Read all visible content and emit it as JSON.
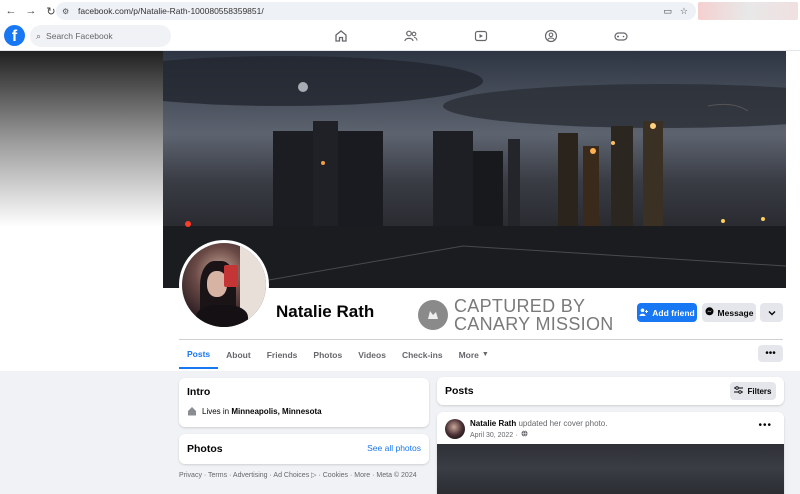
{
  "browser": {
    "url": "facebook.com/p/Natalie-Rath-100080558359851/"
  },
  "nav": {
    "search_placeholder": "Search Facebook"
  },
  "profile": {
    "name": "Natalie Rath",
    "watermark_line1": "CAPTURED BY",
    "watermark_line2": "CANARY MISSION",
    "add_friend_label": "Add friend",
    "message_label": "Message"
  },
  "tabs": [
    {
      "label": "Posts",
      "active": true
    },
    {
      "label": "About"
    },
    {
      "label": "Friends"
    },
    {
      "label": "Photos"
    },
    {
      "label": "Videos"
    },
    {
      "label": "Check-ins"
    },
    {
      "label": "More"
    }
  ],
  "intro": {
    "title": "Intro",
    "lives_prefix": "Lives in",
    "location": "Minneapolis, Minnesota"
  },
  "photos": {
    "title": "Photos",
    "see_all": "See all photos"
  },
  "footer": "Privacy · Terms · Advertising · Ad Choices ▷ · Cookies · More · Meta © 2024",
  "posts": {
    "title": "Posts",
    "filters_label": "Filters",
    "items": [
      {
        "author": "Natalie Rath",
        "action": "updated her cover photo.",
        "date": "April 30, 2022 ·"
      }
    ]
  },
  "colors": {
    "fb_blue": "#1877f2",
    "bg": "#f0f2f5"
  }
}
